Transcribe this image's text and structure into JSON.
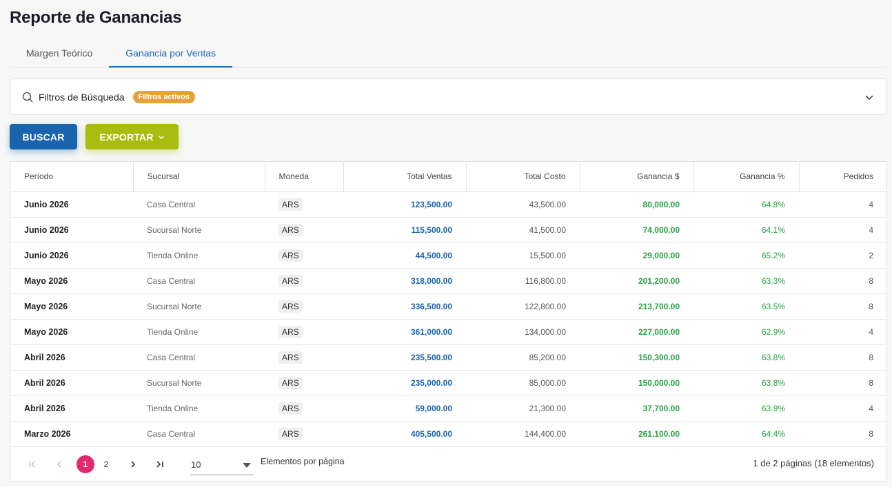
{
  "page": {
    "title": "Reporte de Ganancias"
  },
  "tabs": [
    {
      "label": "Margen Teórico",
      "active": false
    },
    {
      "label": "Ganancia por Ventas",
      "active": true
    }
  ],
  "filters": {
    "title": "Filtros de Búsqueda",
    "badge": "Filtros activos"
  },
  "actions": {
    "search_label": "BUSCAR",
    "export_label": "EXPORTAR"
  },
  "colors": {
    "primary": "#1a64ad",
    "export": "#a9bd10",
    "positive": "#25a243",
    "badge": "#e6a13a",
    "page_active": "#e3286f"
  },
  "table": {
    "columns": [
      "Período",
      "Sucursal",
      "Moneda",
      "Total Ventas",
      "Total Costo",
      "Ganancia $",
      "Ganancia %",
      "Pedidos"
    ],
    "rows": [
      [
        "Junio 2026",
        "Casa Central",
        "ARS",
        "123,500.00",
        "43,500.00",
        "80,000.00",
        "64.8%",
        "4"
      ],
      [
        "Junio 2026",
        "Sucursal Norte",
        "ARS",
        "115,500.00",
        "41,500.00",
        "74,000.00",
        "64.1%",
        "4"
      ],
      [
        "Junio 2026",
        "Tienda Online",
        "ARS",
        "44,500.00",
        "15,500.00",
        "29,000.00",
        "65.2%",
        "2"
      ],
      [
        "Mayo 2026",
        "Casa Central",
        "ARS",
        "318,000.00",
        "116,800.00",
        "201,200.00",
        "63.3%",
        "8"
      ],
      [
        "Mayo 2026",
        "Sucursal Norte",
        "ARS",
        "336,500.00",
        "122,800.00",
        "213,700.00",
        "63.5%",
        "8"
      ],
      [
        "Mayo 2026",
        "Tienda Online",
        "ARS",
        "361,000.00",
        "134,000.00",
        "227,000.00",
        "62.9%",
        "4"
      ],
      [
        "Abril 2026",
        "Casa Central",
        "ARS",
        "235,500.00",
        "85,200.00",
        "150,300.00",
        "63.8%",
        "8"
      ],
      [
        "Abril 2026",
        "Sucursal Norte",
        "ARS",
        "235,000.00",
        "85,000.00",
        "150,000.00",
        "63.8%",
        "8"
      ],
      [
        "Abril 2026",
        "Tienda Online",
        "ARS",
        "59,000.00",
        "21,300.00",
        "37,700.00",
        "63.9%",
        "4"
      ],
      [
        "Marzo 2026",
        "Casa Central",
        "ARS",
        "405,500.00",
        "144,400.00",
        "261,100.00",
        "64.4%",
        "8"
      ]
    ]
  },
  "pagination": {
    "pages": [
      "1",
      "2"
    ],
    "current": "1",
    "page_size": "10",
    "per_page_label": "Elementos por página",
    "info": "1 de 2 páginas (18 elementos)"
  }
}
